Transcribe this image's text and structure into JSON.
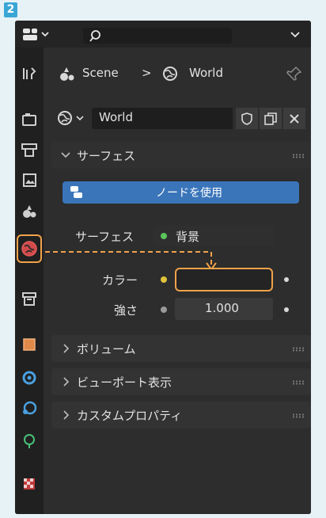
{
  "step_number": "2",
  "breadcrumb": {
    "scene": "Scene",
    "separator": ">",
    "world": "World"
  },
  "datablock": {
    "name": "World"
  },
  "surface_panel": {
    "title": "サーフェス",
    "use_nodes_label": "ノードを使用",
    "surface_label": "サーフェス",
    "surface_value": "背景",
    "color_label": "カラー",
    "strength_label": "強さ",
    "strength_value": "1.000"
  },
  "collapsed_panels": [
    {
      "title": "ボリューム"
    },
    {
      "title": "ビューポート表示"
    },
    {
      "title": "カスタムプロパティ"
    }
  ],
  "colors": {
    "accent_blue": "#3a75ba",
    "highlight_orange": "#f0a24a",
    "socket_green": "#5cc45c",
    "socket_yellow": "#e0c23c",
    "socket_gray": "#9a9a9a"
  },
  "icons": {
    "sidebar_tabs": [
      "tool-icon",
      "render-icon",
      "output-icon",
      "view-layer-icon",
      "scene-icon",
      "world-icon",
      "collection-icon",
      "object-icon",
      "modifier-icon",
      "particles-icon",
      "physics-icon",
      "texture-icon"
    ]
  }
}
